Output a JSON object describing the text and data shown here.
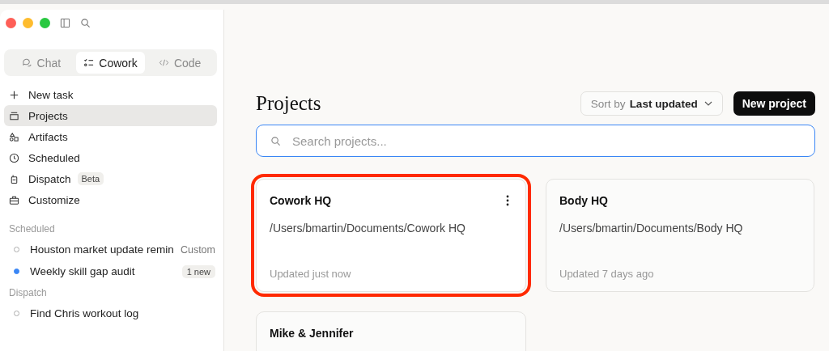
{
  "sidebar": {
    "mode_tabs": [
      {
        "label": "Chat",
        "selected": false
      },
      {
        "label": "Cowork",
        "selected": true
      },
      {
        "label": "Code",
        "selected": false
      }
    ],
    "nav_items": [
      {
        "label": "New task",
        "selected": false
      },
      {
        "label": "Projects",
        "selected": true
      },
      {
        "label": "Artifacts",
        "selected": false
      },
      {
        "label": "Scheduled",
        "selected": false
      },
      {
        "label": "Dispatch",
        "selected": false,
        "badge": "Beta"
      },
      {
        "label": "Customize",
        "selected": false
      }
    ],
    "sections": [
      {
        "title": "Scheduled",
        "items": [
          {
            "label": "Houston market update remin",
            "active": false,
            "trailing": {
              "kind": "text",
              "text": "Custom"
            }
          },
          {
            "label": "Weekly skill gap audit",
            "active": true,
            "trailing": {
              "kind": "badge",
              "text": "1 new"
            }
          }
        ]
      },
      {
        "title": "Dispatch",
        "items": [
          {
            "label": "Find Chris workout log",
            "active": false
          }
        ]
      }
    ]
  },
  "main": {
    "title": "Projects",
    "sort": {
      "prefix": "Sort by",
      "value": "Last updated"
    },
    "new_button": "New project",
    "search": {
      "placeholder": "Search projects..."
    },
    "projects": [
      {
        "name": "Cowork HQ",
        "path": "/Users/bmartin/Documents/Cowork HQ",
        "updated": "Updated just now",
        "highlighted": true,
        "menu": true
      },
      {
        "name": "Body HQ",
        "path": "/Users/bmartin/Documents/Body HQ",
        "updated": "Updated 7 days ago",
        "highlighted": false,
        "menu": false
      },
      {
        "name": "Mike & Jennifer",
        "highlighted": false,
        "menu": false
      }
    ]
  }
}
